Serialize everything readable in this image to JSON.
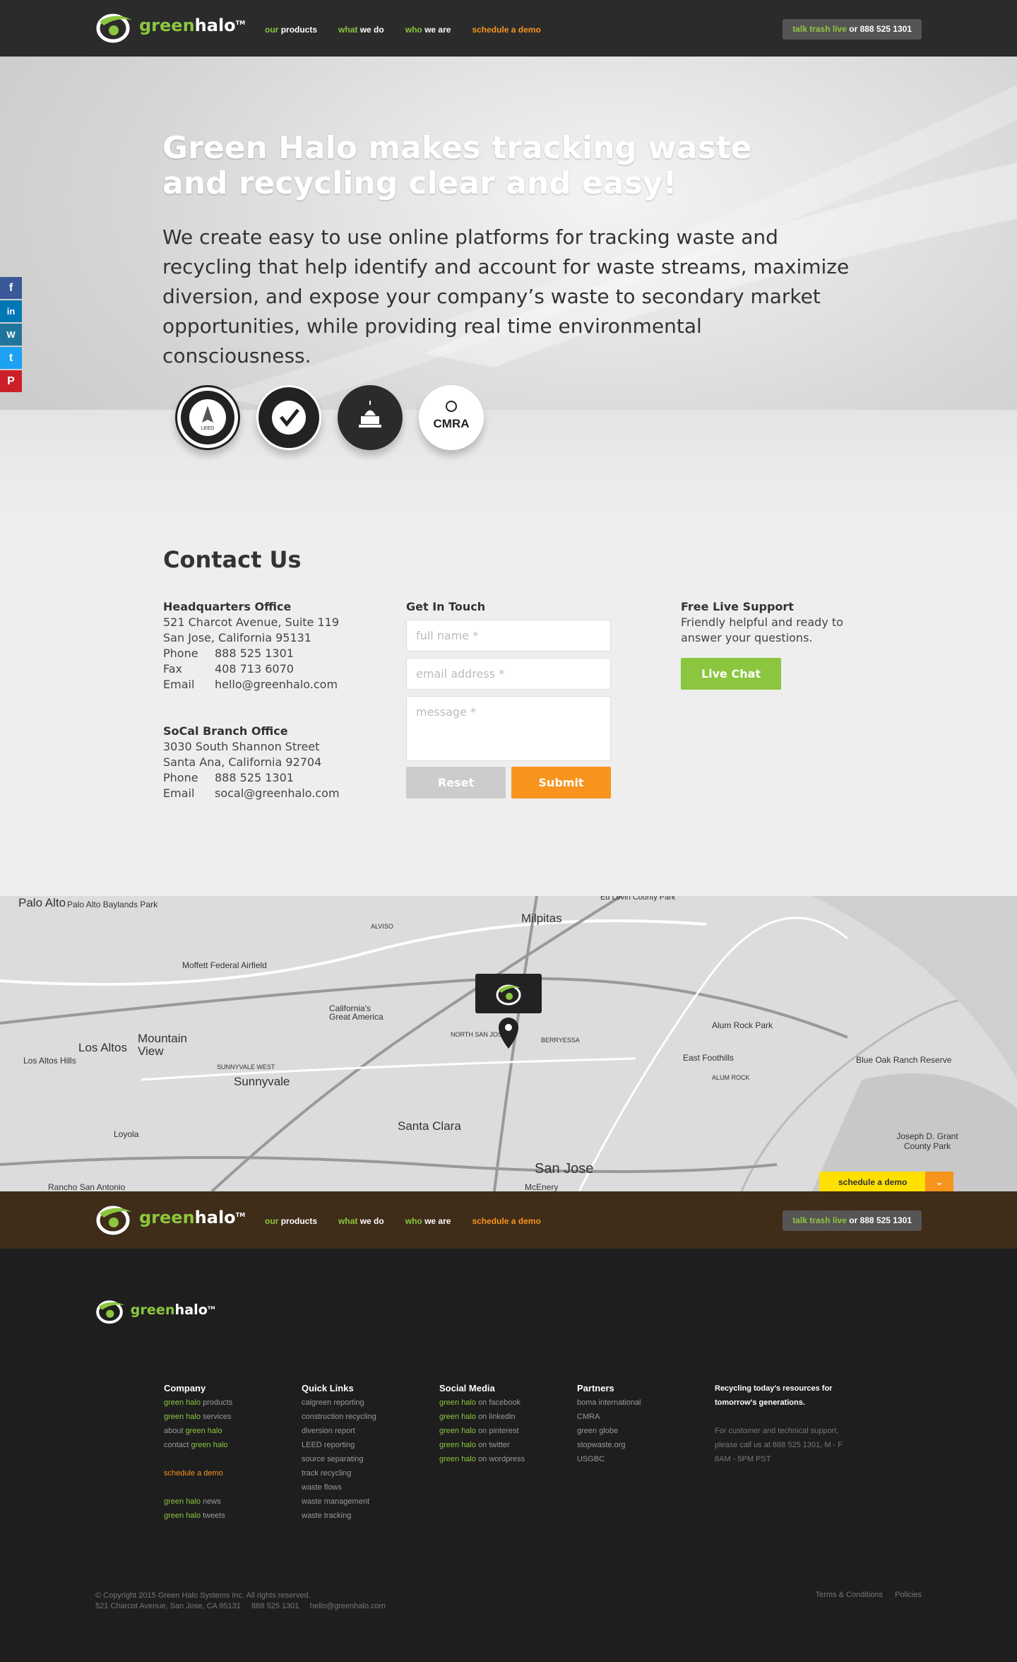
{
  "brand": {
    "name_green": "green",
    "name_white": "halo",
    "tm": "TM"
  },
  "nav": {
    "items": [
      {
        "green": "our",
        "white": "products"
      },
      {
        "green": "what",
        "white": "we do"
      },
      {
        "green": "who",
        "white": "we are"
      },
      {
        "green": "",
        "white": "schedule a demo"
      }
    ],
    "talk_green": "talk trash live",
    "talk_white": "or 888 525 1301"
  },
  "hero": {
    "title": "Green Halo makes tracking waste and recycling clear and easy!",
    "body": "We create easy to use online platforms for tracking waste and recycling that help identify and account for waste streams, maximize diversion, and expose your company’s waste to secondary market opportunities, while providing real time environmental consciousness.",
    "badges": [
      "U.S. GREEN BUILDING COUNCIL LEED USGBC",
      "GREEN GLOBE CERTIFIED",
      "capitol-icon",
      "CMRA"
    ]
  },
  "social": [
    "facebook-icon",
    "linkedin-icon",
    "wordpress-icon",
    "twitter-icon",
    "pinterest-icon"
  ],
  "contact": {
    "title": "Contact Us",
    "hq": {
      "heading": "Headquarters Office",
      "line1": "521 Charcot Avenue, Suite 119",
      "line2": "San Jose, California 95131",
      "phone_label": "Phone",
      "phone": "888 525 1301",
      "fax_label": "Fax",
      "fax": "408 713 6070",
      "email_label": "Email",
      "email": "hello@greenhalo.com"
    },
    "socal": {
      "heading": "SoCal Branch Office",
      "line1": "3030 South Shannon Street",
      "line2": "Santa Ana, California 92704",
      "phone_label": "Phone",
      "phone": "888 525 1301",
      "email_label": "Email",
      "email": "socal@greenhalo.com"
    },
    "form": {
      "heading": "Get In Touch",
      "name_placeholder": "full name *",
      "email_placeholder": "email address *",
      "message_placeholder": "message *",
      "reset": "Reset",
      "submit": "Submit"
    },
    "support": {
      "heading": "Free Live Support",
      "text": "Friendly helpful and ready to answer your questions.",
      "button": "Live Chat"
    }
  },
  "map": {
    "labels": [
      "Palo Alto",
      "Palo Alto Baylands Park",
      "Moffett Federal Airfield",
      "Milpitas",
      "Mountain View",
      "Los Altos",
      "Los Altos Hills",
      "Sunnyvale",
      "Santa Clara",
      "San Jose",
      "Alum Rock Park",
      "East Foothills",
      "Blue Oak Ranch Reserve",
      "Joseph D. Grant County Park",
      "Loyola",
      "California's Great America",
      "Ed Levin County Park",
      "Rancho San Antonio",
      "McEnery",
      "ALVISO",
      "BERRYESSA",
      "NORTH SAN JOSE",
      "SUNNYVALE WEST",
      "ALUM ROCK"
    ],
    "schedule_tab": "schedule a demo"
  },
  "footer": {
    "company": {
      "heading": "Company",
      "links": [
        {
          "g": "green halo",
          "w": "products"
        },
        {
          "g": "green halo",
          "w": "services"
        },
        {
          "w": "about",
          "g": "green halo"
        },
        {
          "w": "contact",
          "g": "green halo"
        }
      ],
      "demo": "schedule a demo",
      "news": [
        {
          "g": "green halo",
          "w": "news"
        },
        {
          "g": "green halo",
          "w": "tweets"
        }
      ]
    },
    "quick": {
      "heading": "Quick Links",
      "links": [
        "calgreen reporting",
        "construction recycling",
        "diversion report",
        "LEED reporting",
        "source separating",
        "track recycling",
        "waste flows",
        "waste management",
        "waste tracking"
      ]
    },
    "social": {
      "heading": "Social Media",
      "links": [
        {
          "g": "green halo",
          "w": "on facebook"
        },
        {
          "g": "green halo",
          "w": "on linkedin"
        },
        {
          "g": "green halo",
          "w": "on pinterest"
        },
        {
          "g": "green halo",
          "w": "on twitter"
        },
        {
          "g": "green halo",
          "w": "on wordpress"
        }
      ]
    },
    "partners": {
      "heading": "Partners",
      "links": [
        "boma international",
        "CMRA",
        "green globe",
        "stopwaste.org",
        "USGBC"
      ]
    },
    "tagline": "Recycling today's resources for tomorrow's generations.",
    "support": "For customer and technical support, please call us at 888 525 1301, M - F 8AM - 5PM PST",
    "copyright": "© Copyright 2015 Green Halo Systems Inc.  All rights reserved.",
    "address": "521 Charcot Avenue, San Jose, CA 95131     888 525 1301     hello@greenhalo.com",
    "terms": "Terms & Conditions",
    "policies": "Policies"
  },
  "colors": {
    "green": "#8cc63f",
    "orange": "#f7941d",
    "dark": "#2b2b2b",
    "brown": "#3f2c19",
    "footer": "#1e1e1e",
    "yellow": "#ffe000"
  }
}
